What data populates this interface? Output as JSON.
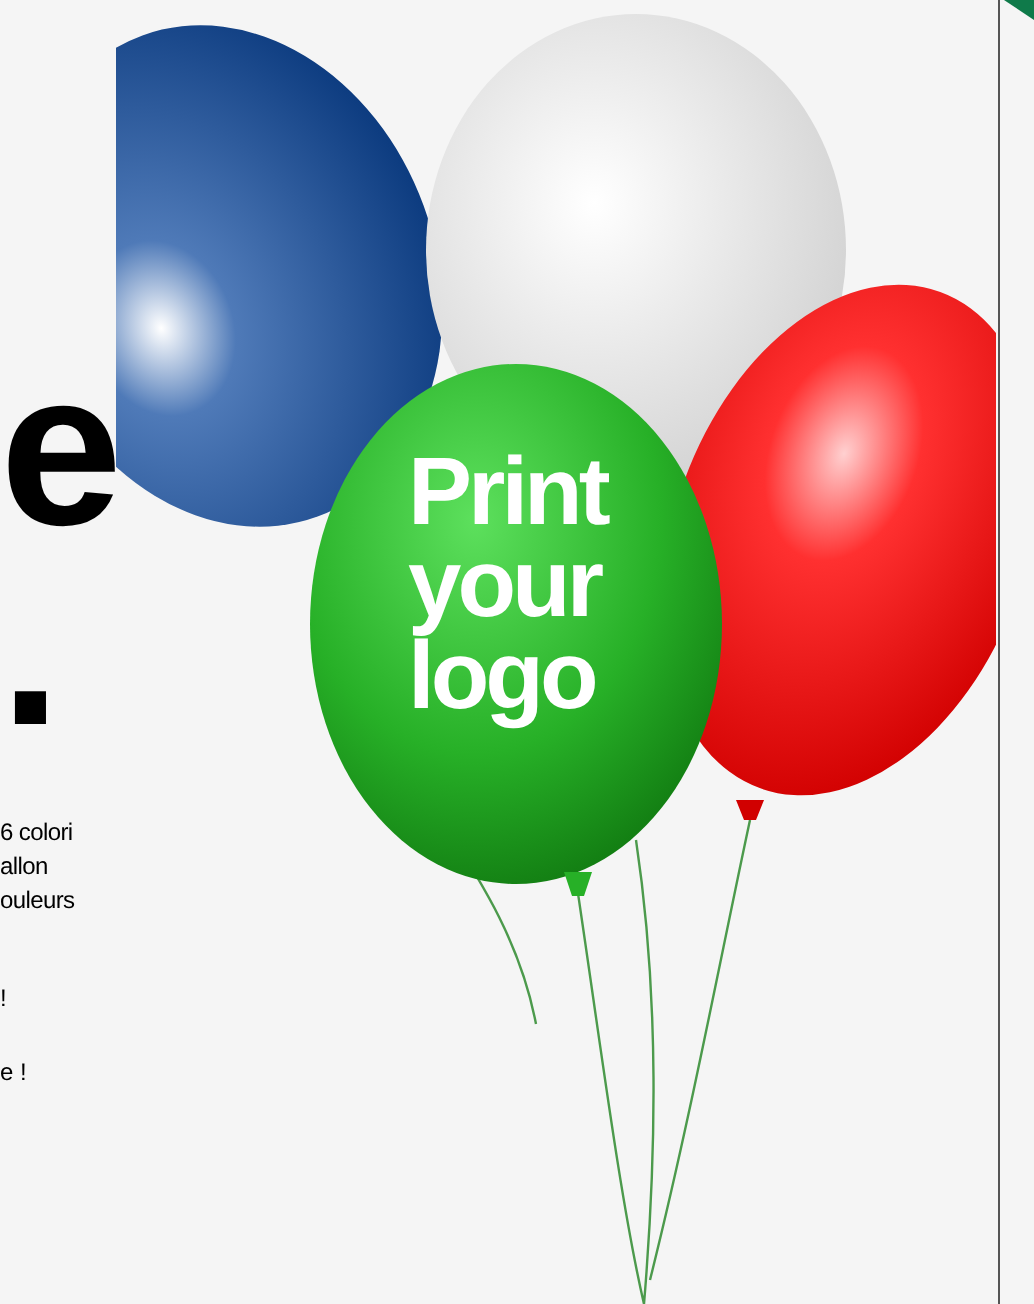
{
  "headline": {
    "letter": "e",
    "period": "."
  },
  "balloon_text": [
    "Print",
    "your",
    "logo"
  ],
  "description": [
    "6 colori",
    "allon",
    "ouleurs"
  ],
  "notes": [
    "!",
    "e !"
  ]
}
